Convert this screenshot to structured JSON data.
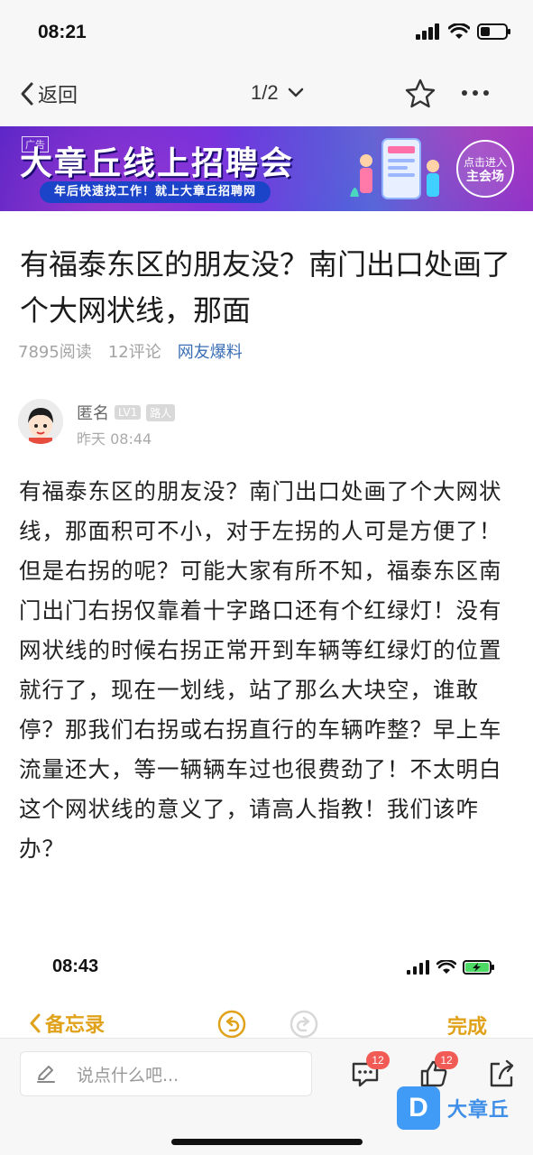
{
  "status_bar": {
    "time": "08:21"
  },
  "nav": {
    "back_label": "返回",
    "page_indicator": "1/2"
  },
  "banner": {
    "tag": "广告",
    "title": "大章丘线上招聘会",
    "subtitle": "年后快速找工作！就上大章丘招聘网",
    "cta_line1": "点击进入",
    "cta_line2": "主会场"
  },
  "article": {
    "title": "有福泰东区的朋友没？南门出口处画了个大网状线，那面",
    "reads": "7895阅读",
    "comments": "12评论",
    "category": "网友爆料",
    "author_name": "匿名",
    "author_level": "LV1",
    "author_rank": "路人",
    "post_time": "昨天 08:44",
    "body": "有福泰东区的朋友没？南门出口处画了个大网状线，那面积可不小，对于左拐的人可是方便了！但是右拐的呢？可能大家有所不知，福泰东区南门出门右拐仅靠着十字路口还有个红绿灯！没有网状线的时候右拐正常开到车辆等红绿灯的位置就行了，现在一划线，站了那么大块空，谁敢停？那我们右拐或右拐直行的车辆咋整？早上车流量还大，等一辆辆车过也很费劲了！不太明白这个网状线的意义了，请高人指教！我们该咋办？"
  },
  "embedded_screenshot": {
    "time": "08:43",
    "back_label": "备忘录",
    "done_label": "完成"
  },
  "comment_bar": {
    "placeholder": "说点什么吧...",
    "comment_count": "12",
    "like_count": "12"
  },
  "watermark": {
    "logo_letter": "D",
    "text": "大章丘"
  },
  "colors": {
    "accent_blue": "#3a6fb5",
    "badge_red": "#f25a55",
    "notes_yellow": "#e0a21a"
  }
}
